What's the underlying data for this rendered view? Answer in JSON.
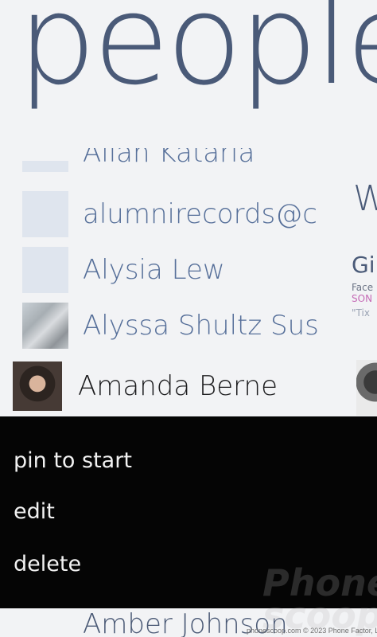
{
  "page": {
    "title": "people"
  },
  "contacts": [
    {
      "name": "Allan Kataria",
      "photo": "none",
      "cut": "top"
    },
    {
      "name": "alumnirecords@c",
      "photo": "none"
    },
    {
      "name": "Alysia Lew",
      "photo": "none"
    },
    {
      "name": "Alyssa Shultz Sus",
      "photo": "grayscale-photo"
    },
    {
      "name": "Amanda Berne",
      "photo": "portrait-photo",
      "selected": true
    },
    {
      "name": "Amber Johnson",
      "photo": "none",
      "cut": "bottom"
    }
  ],
  "side_panel": {
    "heading": "W",
    "item": "Gi",
    "sub1": "Face",
    "sub2": "SON",
    "sub3": "\"Tix"
  },
  "context_menu": {
    "items": [
      "pin to start",
      "edit",
      "delete"
    ]
  },
  "watermark": {
    "brand": "Phone\nscoop",
    "footer": "phonescoop.com  © 2023 Phone Factor, LLC"
  },
  "colors": {
    "title": "#4a5a78",
    "contact_name": "#57709a",
    "selected_name": "#1d1d1f",
    "menu_bg": "#050505",
    "menu_text": "#f2f2f2",
    "accent_pink": "#c56ab6"
  }
}
